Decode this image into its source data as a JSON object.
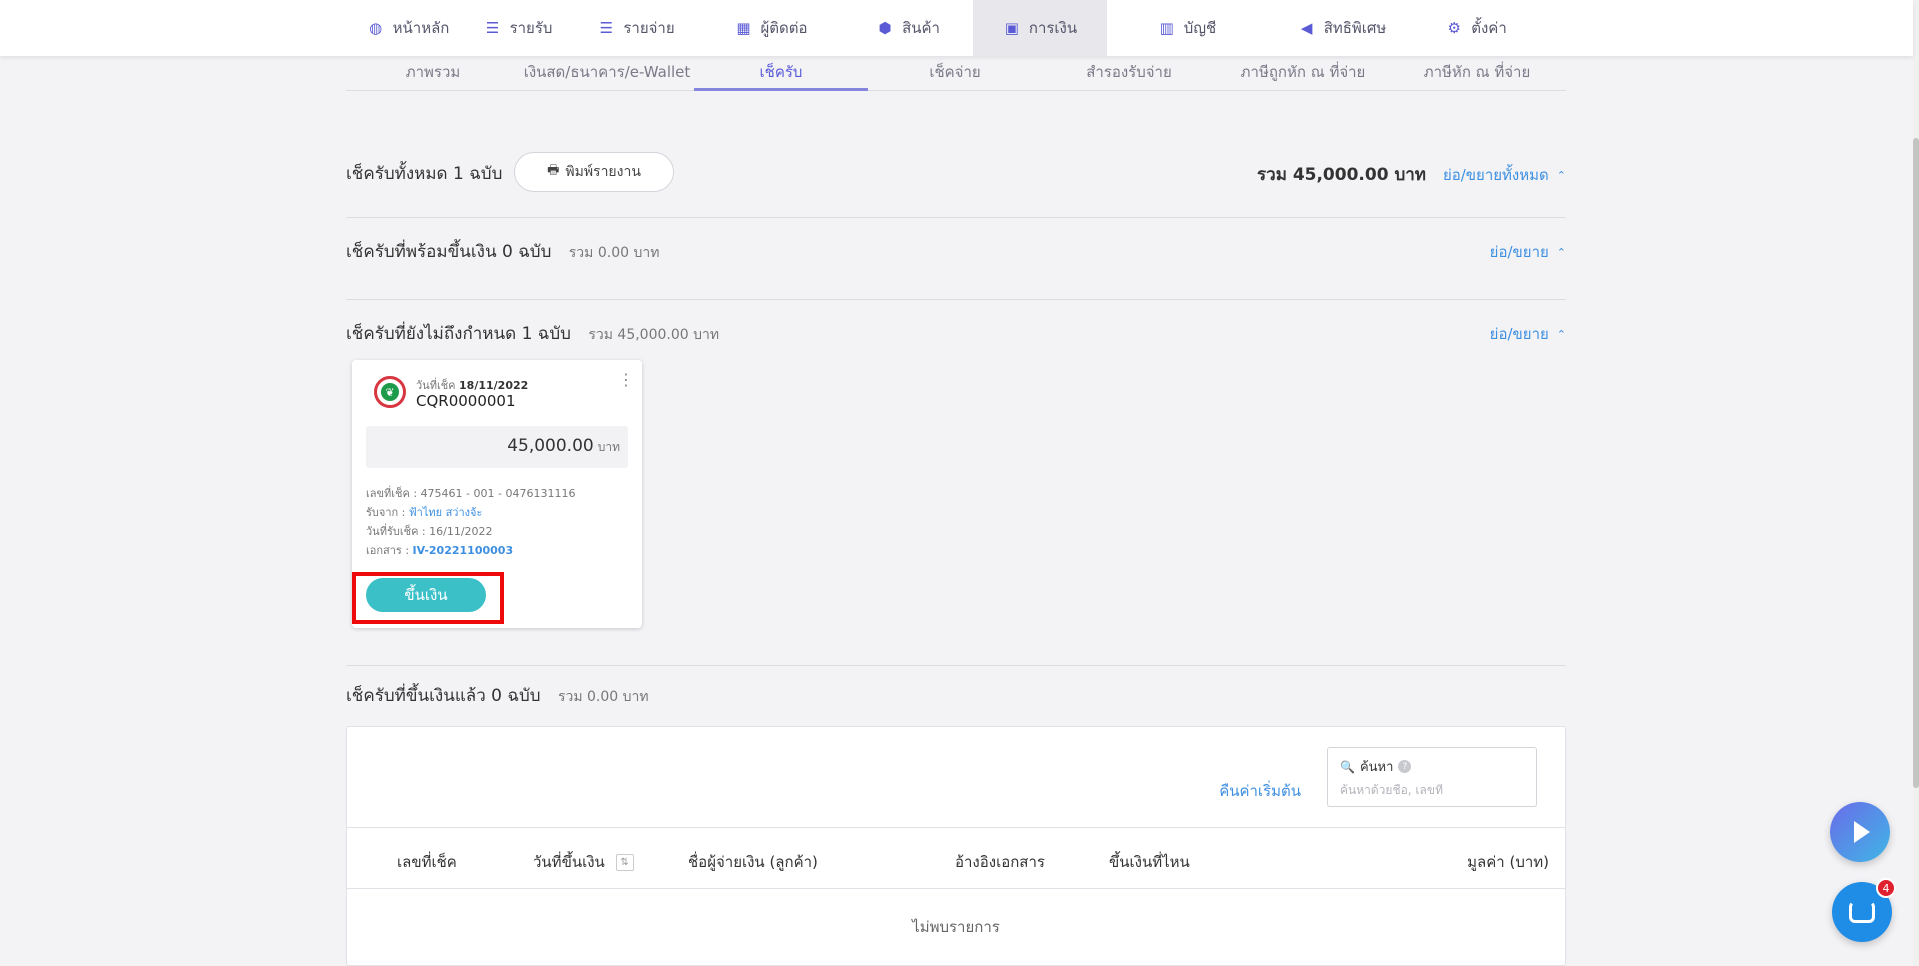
{
  "nav": {
    "items": [
      {
        "label": "หน้าหลัก",
        "icon": "dashboard-icon",
        "glyph": "◍"
      },
      {
        "label": "รายรับ",
        "icon": "income-icon",
        "glyph": "☰"
      },
      {
        "label": "รายจ่าย",
        "icon": "expense-icon",
        "glyph": "☰"
      },
      {
        "label": "ผู้ติดต่อ",
        "icon": "contacts-icon",
        "glyph": "▦"
      },
      {
        "label": "สินค้า",
        "icon": "product-box-icon",
        "glyph": "⬢"
      },
      {
        "label": "การเงิน",
        "icon": "finance-cash-icon",
        "glyph": "▣"
      },
      {
        "label": "บัญชี",
        "icon": "accounting-book-icon",
        "glyph": "▥"
      },
      {
        "label": "สิทธิพิเศษ",
        "icon": "megaphone-icon",
        "glyph": "◀"
      },
      {
        "label": "ตั้งค่า",
        "icon": "gear-icon",
        "glyph": "⚙"
      }
    ],
    "active_index": 5
  },
  "subtabs": {
    "items": [
      "ภาพรวม",
      "เงินสด/ธนาคาร/e-Wallet",
      "เช็ครับ",
      "เช็คจ่าย",
      "สำรองรับจ่าย",
      "ภาษีถูกหัก ณ ที่จ่าย",
      "ภาษีหัก ณ ที่จ่าย"
    ],
    "active_index": 2
  },
  "summary": {
    "title": "เช็ครับทั้งหมด 1 ฉบับ",
    "print_label": "พิมพ์รายงาน",
    "total": "รวม 45,000.00 บาท",
    "toggle_all": "ย่อ/ขยายทั้งหมด"
  },
  "sections": {
    "ready": {
      "title": "เช็ครับที่พร้อมขึ้นเงิน 0 ฉบับ",
      "sum": "รวม 0.00 บาท",
      "toggle": "ย่อ/ขยาย"
    },
    "not_due": {
      "title": "เช็ครับที่ยังไม่ถึงกำหนด 1 ฉบับ",
      "sum": "รวม 45,000.00 บาท",
      "toggle": "ย่อ/ขยาย"
    },
    "deposited": {
      "title": "เช็ครับที่ขึ้นเงินแล้ว 0 ฉบับ",
      "sum": "รวม 0.00 บาท"
    }
  },
  "cheque": {
    "date_label": "วันที่เช็ค",
    "date": "18/11/2022",
    "number": "CQR0000001",
    "amount": "45,000.00",
    "unit": "บาท",
    "cheque_no_label": "เลขที่เช็ค :",
    "cheque_no": "475461 - 001 - 0476131116",
    "received_from_label": "รับจาก :",
    "received_from": "ฟ้าไทย สว่างจ้ะ",
    "received_date_label": "วันที่รับเช็ค :",
    "received_date": "16/11/2022",
    "document_label": "เอกสาร :",
    "document": "IV-20221100003",
    "deposit_label": "ขึ้นเงิน"
  },
  "table": {
    "reset_label": "คืนค่าเริ่มต้น",
    "search_label": "ค้นหา",
    "search_placeholder": "ค้นหาด้วยชื่อ, เลขที่",
    "search_value": "",
    "columns": [
      "เลขที่เช็ค",
      "วันที่ขึ้นเงิน",
      "ชื่อผู้จ่ายเงิน (ลูกค้า)",
      "อ้างอิงเอกสาร",
      "ขึ้นเงินที่ไหน",
      "มูลค่า (บาท)"
    ],
    "empty": "ไม่พบรายการ"
  },
  "chat": {
    "badge": "4"
  },
  "colors": {
    "accent": "#5b5bd6",
    "link": "#3d8fe0",
    "deposit_button": "#3bc0c8",
    "highlight": "#ee0a0a"
  }
}
